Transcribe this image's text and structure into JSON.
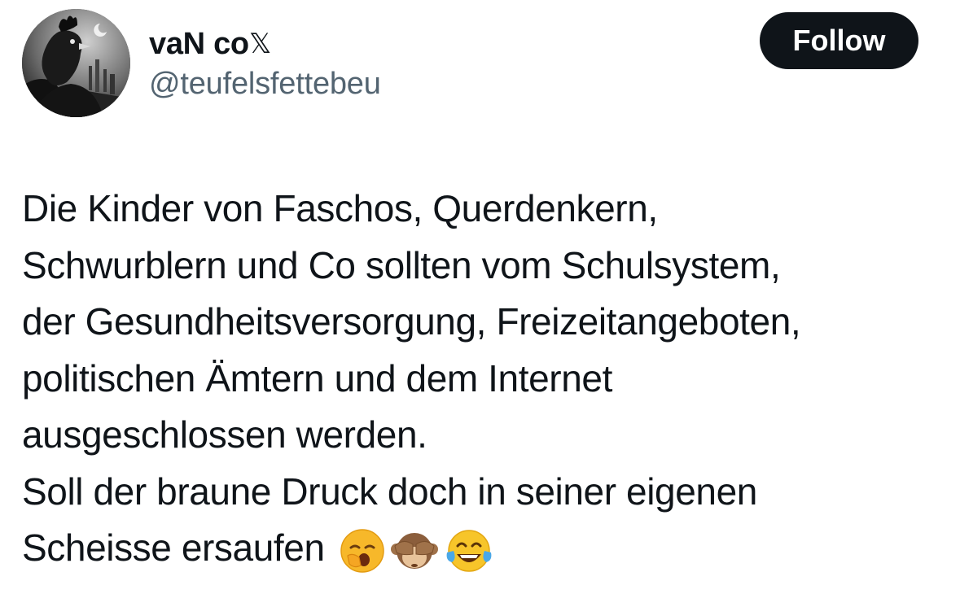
{
  "author": {
    "display_name": "vaN co",
    "verified_glyph": "𝕏",
    "handle": "@teufelsfettebeu",
    "avatar_icon": "rooster-avatar-icon"
  },
  "actions": {
    "follow_label": "Follow"
  },
  "tweet": {
    "lines": [
      "Die Kinder von Faschos, Querdenkern,",
      "Schwurblern und Co sollten vom Schulsystem,",
      "der Gesundheitsversorgung, Freizeitangeboten,",
      "politischen Ämtern und dem Internet",
      "ausgeschlossen werden.",
      "Soll der braune Druck doch in seiner eigenen",
      "Scheisse ersaufen"
    ],
    "emojis": [
      "yawning-face-emoji",
      "see-no-evil-monkey-emoji",
      "face-with-tears-of-joy-emoji"
    ]
  },
  "colors": {
    "text_primary": "#0f1419",
    "text_secondary": "#536471",
    "button_bg": "#0f1419",
    "button_text": "#ffffff",
    "background": "#ffffff"
  }
}
